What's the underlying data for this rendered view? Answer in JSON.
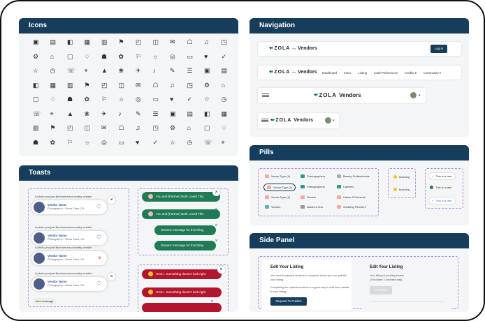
{
  "sections": {
    "icons": "Icons",
    "toasts": "Toasts",
    "navigation": "Navigation",
    "pills": "Pills",
    "side_panel": "Side Panel"
  },
  "nav": {
    "logo_text": "ZOLA",
    "for_text": "for",
    "vendors": "Vendors",
    "login": "Log In",
    "links": [
      "Dashboard",
      "Inbox",
      "Listing",
      "Lead Preferences",
      "Credits",
      "Community"
    ]
  },
  "toasts": {
    "liked_message": "A photo you just liked serves a nearby vendor!",
    "vendor_name": "Vendor Name",
    "vendor_loc": "Photography • Santa Clara, CA",
    "new_message": "New message",
    "both_loved": "You and [Partner] Both Loved This",
    "generic": "Generic message for this thing.",
    "error": "Hmm.. Something doesn't look right."
  },
  "pills": {
    "venue_type": "Venue Type (4)",
    "venues": "Venues",
    "photographers": "Photographers",
    "videographers": "Videographers",
    "florists": "Florists",
    "bands": "Bands & DJs",
    "beauty": "Beauty Professionals",
    "caterers": "Caterers",
    "cakes": "Cakes & Desserts",
    "planners": "Wedding Planners",
    "teaching": "teaching",
    "task": "This is a task"
  },
  "side_panel": {
    "edit_title": "Edit Your Listing",
    "required_text": "You have 8 required sections to complete before you can publish your listing.",
    "optional_text": "Completing the optional sections is a good way to add more details to your listing.",
    "request_btn": "Request To Publish",
    "pending_text": "Your listing is pending review",
    "pending_text2": "(This takes 3 business day)",
    "in_review": "In Review"
  },
  "colors": {
    "header": "#173d5c",
    "green_toast": "#1f7a56",
    "red_toast": "#b3152e",
    "accent": "#2a9c8f"
  }
}
